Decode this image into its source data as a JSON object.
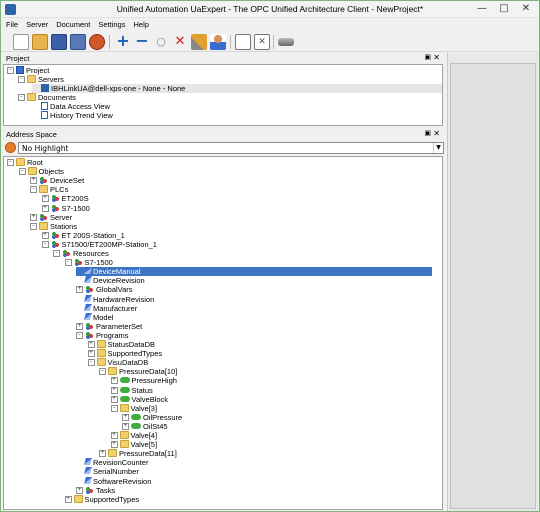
{
  "window": {
    "title": "Unified Automation UaExpert - The OPC Unified Architecture Client - NewProject*"
  },
  "menu": [
    "File",
    "Server",
    "Document",
    "Settings",
    "Help"
  ],
  "toolbar_icons": [
    "new-icon",
    "open-icon",
    "save-icon",
    "save-as-icon",
    "disconnect-icon",
    "add-server-icon",
    "remove-icon",
    "connect-icon",
    "delete-icon",
    "settings-icon",
    "user-icon",
    "document-icon",
    "delete-document-icon",
    "gateway-icon"
  ],
  "project_panel": {
    "title": "Project",
    "items": [
      {
        "label": "Project",
        "level": 0
      },
      {
        "label": "Servers",
        "level": 1
      },
      {
        "label": "IBHLinkUA@dell-xps-one - None - None",
        "level": 2
      },
      {
        "label": "Documents",
        "level": 1
      },
      {
        "label": "Data Access View",
        "level": 2
      },
      {
        "label": "History Trend View",
        "level": 2
      }
    ]
  },
  "address_space": {
    "title": "Address Space",
    "highlight": "No Highlight",
    "tree": [
      {
        "label": "Root",
        "level": 0,
        "icon": "folder",
        "exp": "-"
      },
      {
        "label": "Objects",
        "level": 1,
        "icon": "folder",
        "exp": "-"
      },
      {
        "label": "DeviceSet",
        "level": 2,
        "icon": "obj",
        "exp": "+"
      },
      {
        "label": "PLCs",
        "level": 2,
        "icon": "folder",
        "exp": "-"
      },
      {
        "label": "ET200S",
        "level": 3,
        "icon": "obj",
        "exp": "+"
      },
      {
        "label": "S7-1500",
        "level": 3,
        "icon": "obj",
        "exp": "+"
      },
      {
        "label": "Server",
        "level": 2,
        "icon": "obj",
        "exp": "+"
      },
      {
        "label": "Stations",
        "level": 2,
        "icon": "folder",
        "exp": "-"
      },
      {
        "label": "ET 200S-Station_1",
        "level": 3,
        "icon": "obj",
        "exp": "+"
      },
      {
        "label": "S71500/ET200MP-Station_1",
        "level": 3,
        "icon": "obj",
        "exp": "-"
      },
      {
        "label": "Resources",
        "level": 4,
        "icon": "obj",
        "exp": "-"
      },
      {
        "label": "S7-1500",
        "level": 5,
        "icon": "obj",
        "exp": "-"
      },
      {
        "label": "DeviceManual",
        "level": 6,
        "icon": "var",
        "exp": "",
        "selected": true
      },
      {
        "label": "DeviceRevision",
        "level": 6,
        "icon": "var",
        "exp": ""
      },
      {
        "label": "GlobalVars",
        "level": 6,
        "icon": "obj",
        "exp": "+"
      },
      {
        "label": "HardwareRevision",
        "level": 6,
        "icon": "var",
        "exp": ""
      },
      {
        "label": "Manufacturer",
        "level": 6,
        "icon": "var",
        "exp": ""
      },
      {
        "label": "Model",
        "level": 6,
        "icon": "var",
        "exp": ""
      },
      {
        "label": "ParameterSet",
        "level": 6,
        "icon": "obj",
        "exp": "+"
      },
      {
        "label": "Programs",
        "level": 6,
        "icon": "obj",
        "exp": "-"
      },
      {
        "label": "StatusDataDB",
        "level": 7,
        "icon": "folder",
        "exp": "+"
      },
      {
        "label": "SupportedTypes",
        "level": 7,
        "icon": "folder",
        "exp": "+"
      },
      {
        "label": "VisuDataDB",
        "level": 7,
        "icon": "folder",
        "exp": "-"
      },
      {
        "label": "PressureData[10]",
        "level": 8,
        "icon": "folder",
        "exp": "-"
      },
      {
        "label": "PressureHigh",
        "level": 9,
        "icon": "varg",
        "exp": "+"
      },
      {
        "label": "Status",
        "level": 9,
        "icon": "varg",
        "exp": "+"
      },
      {
        "label": "ValveBlock",
        "level": 9,
        "icon": "varg",
        "exp": "+"
      },
      {
        "label": "Valve[3]",
        "level": 9,
        "icon": "folder",
        "exp": "-"
      },
      {
        "label": "OilPressure",
        "level": 10,
        "icon": "varg",
        "exp": "+"
      },
      {
        "label": "OilSt45",
        "level": 10,
        "icon": "varg",
        "exp": "+"
      },
      {
        "label": "Valve[4]",
        "level": 9,
        "icon": "folder",
        "exp": "+"
      },
      {
        "label": "Valve[5]",
        "level": 9,
        "icon": "folder",
        "exp": "+"
      },
      {
        "label": "PressureData[11]",
        "level": 8,
        "icon": "folder",
        "exp": "+"
      },
      {
        "label": "RevisionCounter",
        "level": 6,
        "icon": "var",
        "exp": ""
      },
      {
        "label": "SerialNumber",
        "level": 6,
        "icon": "var",
        "exp": ""
      },
      {
        "label": "SoftwareRevision",
        "level": 6,
        "icon": "var",
        "exp": ""
      },
      {
        "label": "Tasks",
        "level": 6,
        "icon": "obj",
        "exp": "+"
      },
      {
        "label": "SupportedTypes",
        "level": 5,
        "icon": "folder",
        "exp": "+"
      }
    ]
  },
  "colors": {
    "selection": "#3d74c4",
    "folder": "#f1cf6b"
  }
}
